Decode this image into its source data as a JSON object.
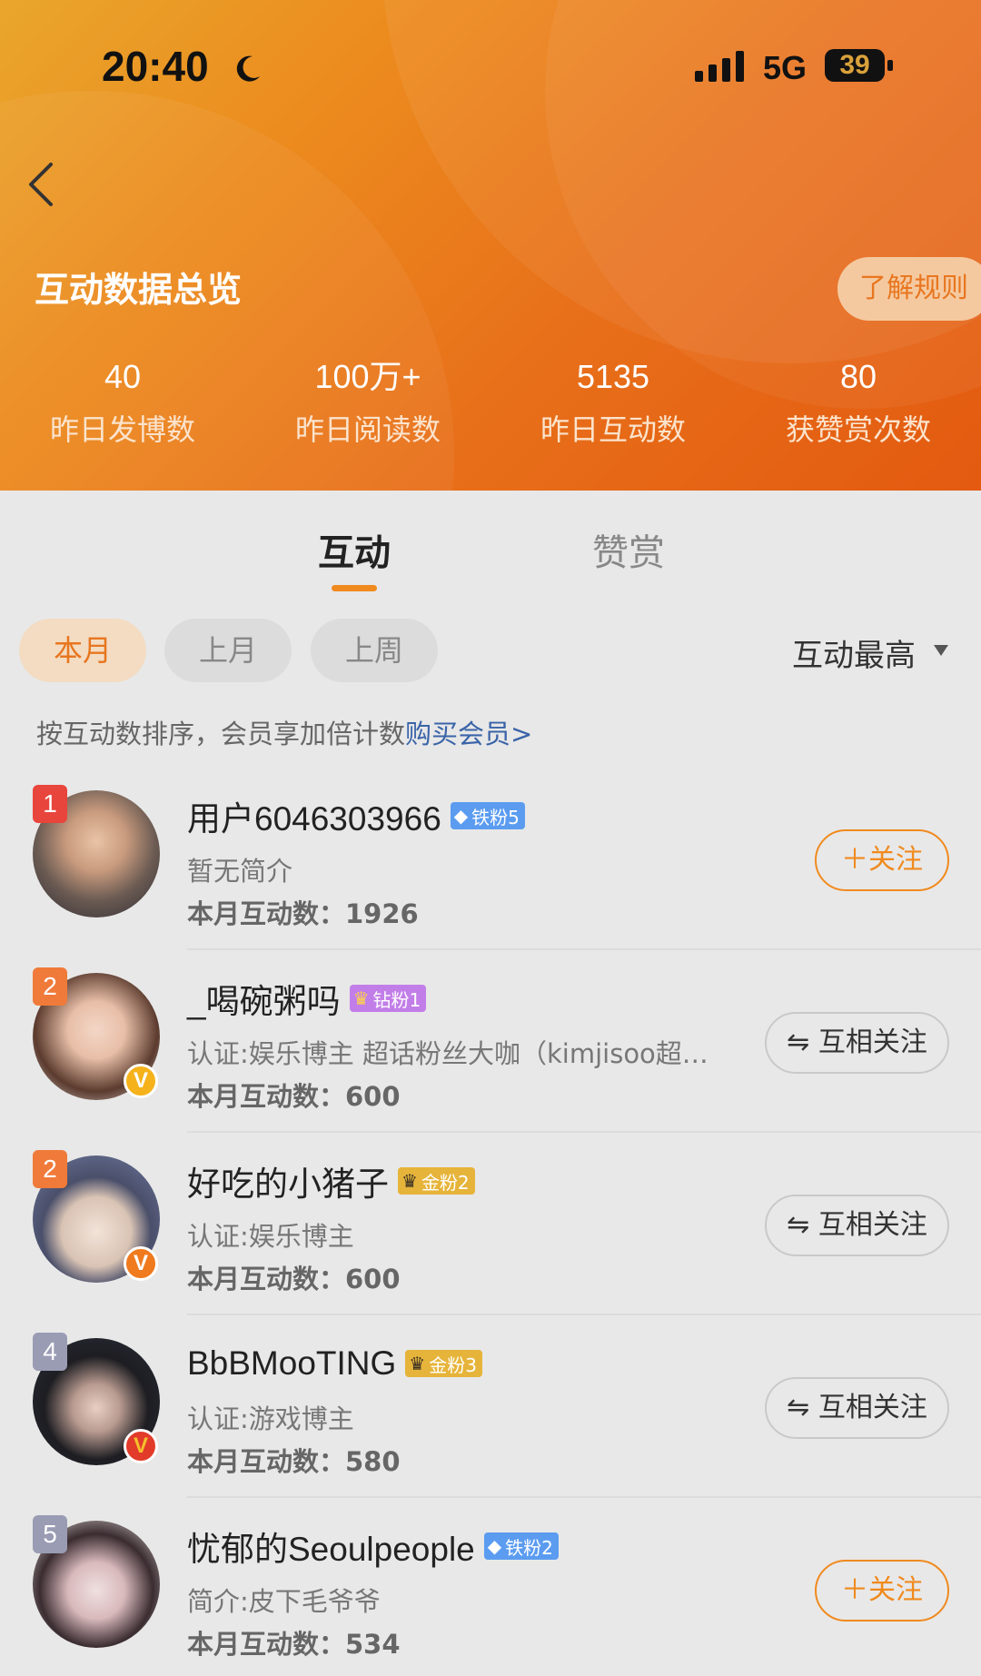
{
  "status_bar": {
    "time": "20:40",
    "network": "5G",
    "battery": "39"
  },
  "header": {
    "title": "互动数据总览",
    "rules_label": "了解规则",
    "stats": [
      {
        "value": "40",
        "label": "昨日发博数"
      },
      {
        "value": "100万+",
        "label": "昨日阅读数"
      },
      {
        "value": "5135",
        "label": "昨日互动数"
      },
      {
        "value": "80",
        "label": "获赞赏次数"
      }
    ]
  },
  "tabs": [
    {
      "label": "互动"
    },
    {
      "label": "赞赏"
    }
  ],
  "filters": {
    "pills": [
      {
        "label": "本月"
      },
      {
        "label": "上月"
      },
      {
        "label": "上周"
      }
    ],
    "sort_label": "互动最高"
  },
  "hint": {
    "text": "按互动数排序，会员享加倍计数",
    "link": "购买会员>"
  },
  "users": [
    {
      "rank": "1",
      "name": "用户6046303966",
      "badge": "铁粉5",
      "desc": "暂无简介",
      "count": "本月互动数：1926",
      "action": "＋关注",
      "verified": false
    },
    {
      "rank": "2",
      "name": "_喝碗粥吗",
      "badge": "钻粉1",
      "desc": "认证:娱乐博主 超话粉丝大咖（kimjisoo超…",
      "count": "本月互动数：600",
      "action": "⇋ 互相关注",
      "verified": true
    },
    {
      "rank": "2",
      "name": "好吃的小猪子",
      "badge": "金粉2",
      "desc": "认证:娱乐博主",
      "count": "本月互动数：600",
      "action": "⇋ 互相关注",
      "verified": true
    },
    {
      "rank": "4",
      "name": "BbBMooTING",
      "badge": "金粉3",
      "desc": "认证:游戏博主",
      "count": "本月互动数：580",
      "action": "⇋ 互相关注",
      "verified": true
    },
    {
      "rank": "5",
      "name": "忧郁的Seoulpeople",
      "badge": "铁粉2",
      "desc": "简介:皮下毛爷爷",
      "count": "本月互动数：534",
      "action": "＋关注",
      "verified": false
    }
  ],
  "colors": {
    "accent": "#f08a1e",
    "link": "#3a64a8",
    "rank_top": "#e8453c",
    "rank_mid": "#f07a3a",
    "rank_low": "#9a9cb4"
  }
}
